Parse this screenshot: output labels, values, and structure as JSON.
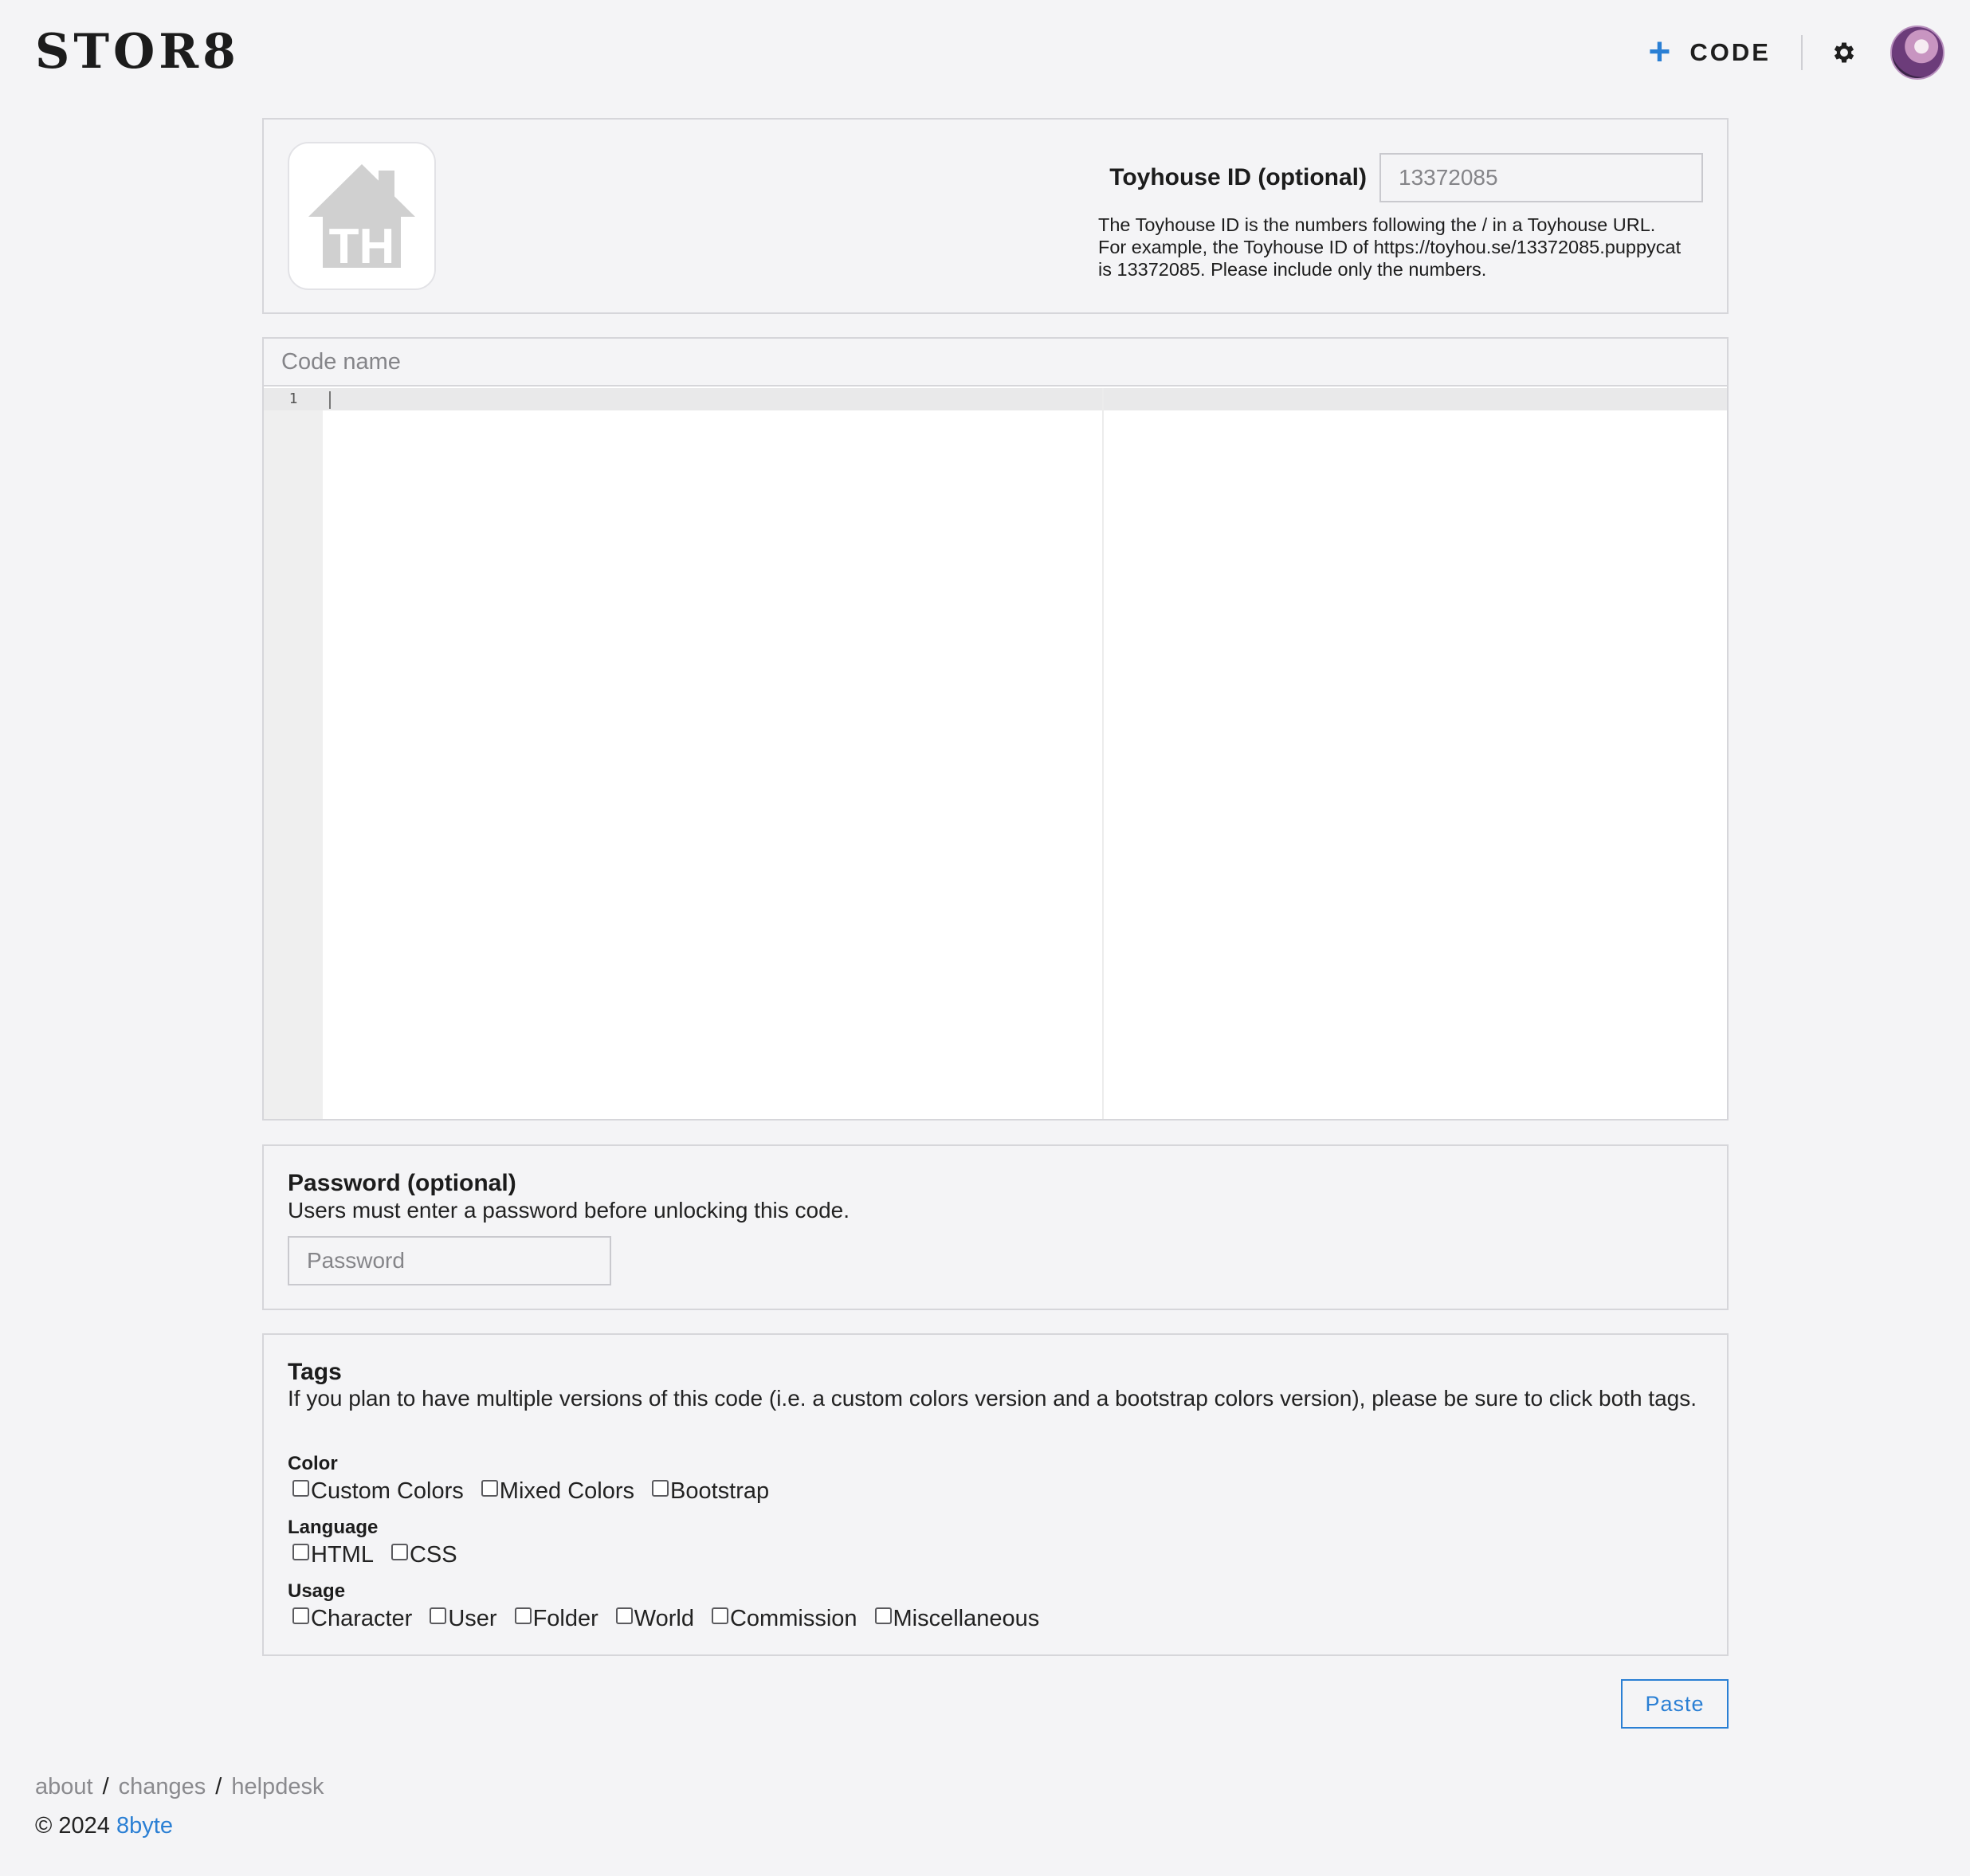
{
  "header": {
    "logo": "STOR8",
    "add_code_label": "CODE",
    "icons": {
      "add": "plus-icon",
      "settings": "gear-icon",
      "avatar": "user-avatar"
    },
    "accent": "#2a7fd4"
  },
  "toyhouse": {
    "label": "Toyhouse ID (optional)",
    "placeholder": "13372085",
    "help_line1": "The Toyhouse ID is the numbers following the / in a Toyhouse URL.",
    "help_line2": "For example, the Toyhouse ID of https://toyhou.se/13372085.puppycat",
    "help_line3": "is 13372085. Please include only the numbers.",
    "logo_text": "TH"
  },
  "editor": {
    "name_placeholder": "Code name",
    "line_number": "1"
  },
  "password": {
    "title": "Password (optional)",
    "description": "Users must enter a password before unlocking this code.",
    "placeholder": "Password"
  },
  "tags": {
    "title": "Tags",
    "description": "If you plan to have multiple versions of this code (i.e. a custom colors version and a bootstrap colors version), please be sure to click both tags.",
    "color_label": "Color",
    "color_options": [
      "Custom Colors",
      "Mixed Colors",
      "Bootstrap"
    ],
    "language_label": "Language",
    "language_options": [
      "HTML",
      "CSS"
    ],
    "usage_label": "Usage",
    "usage_options": [
      "Character",
      "User",
      "Folder",
      "World",
      "Commission",
      "Miscellaneous"
    ]
  },
  "actions": {
    "paste_label": "Paste"
  },
  "footer": {
    "links": [
      "about",
      "changes",
      "helpdesk"
    ],
    "separator": "/",
    "copyright": "© 2024",
    "brand": "8byte"
  }
}
